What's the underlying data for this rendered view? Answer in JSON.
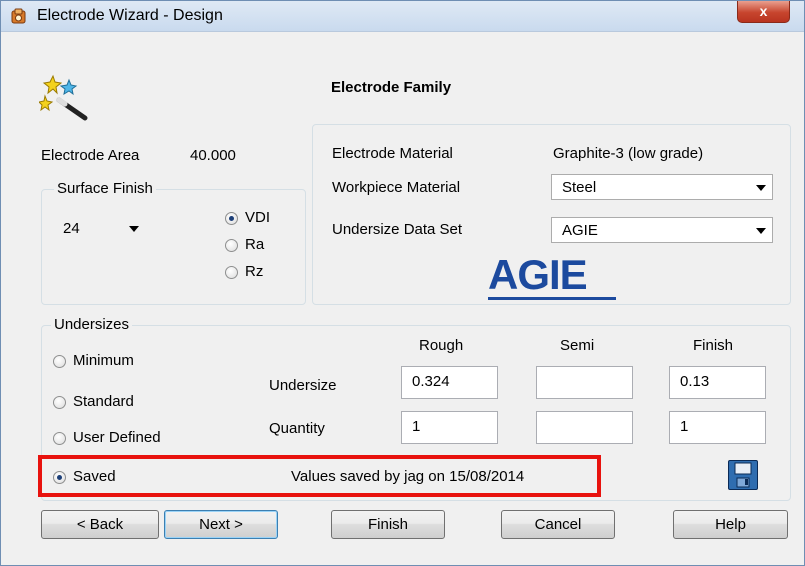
{
  "window": {
    "title": "Electrode Wizard - Design",
    "close_glyph": "x"
  },
  "header": {
    "title": "Electrode Family"
  },
  "electrode_area": {
    "label": "Electrode Area",
    "value": "40.000"
  },
  "surface_finish": {
    "label": "Surface Finish",
    "value": "24",
    "options": [
      {
        "label": "VDI",
        "checked": true
      },
      {
        "label": "Ra",
        "checked": false
      },
      {
        "label": "Rz",
        "checked": false
      }
    ]
  },
  "materials": {
    "electrode_label": "Electrode Material",
    "electrode_value": "Graphite-3 (low grade)",
    "workpiece_label": "Workpiece Material",
    "workpiece_value": "Steel",
    "undersize_set_label": "Undersize Data Set",
    "undersize_set_value": "AGIE",
    "logo_text": "AGIE",
    "logo_color": "#1c4a9e"
  },
  "undersizes": {
    "label": "Undersizes",
    "modes": [
      {
        "label": "Minimum",
        "checked": false
      },
      {
        "label": "Standard",
        "checked": false
      },
      {
        "label": "User Defined",
        "checked": false
      },
      {
        "label": "Saved",
        "checked": true
      }
    ],
    "columns": [
      "Rough",
      "Semi",
      "Finish"
    ],
    "rows": [
      {
        "label": "Undersize",
        "values": [
          "0.324",
          "",
          "0.13"
        ]
      },
      {
        "label": "Quantity",
        "values": [
          "1",
          "",
          "1"
        ]
      }
    ],
    "saved_note": "Values saved by jag on 15/08/2014",
    "highlight_color": "#e8120e"
  },
  "buttons": {
    "back": "< Back",
    "next": "Next >",
    "finish": "Finish",
    "cancel": "Cancel",
    "help": "Help"
  }
}
